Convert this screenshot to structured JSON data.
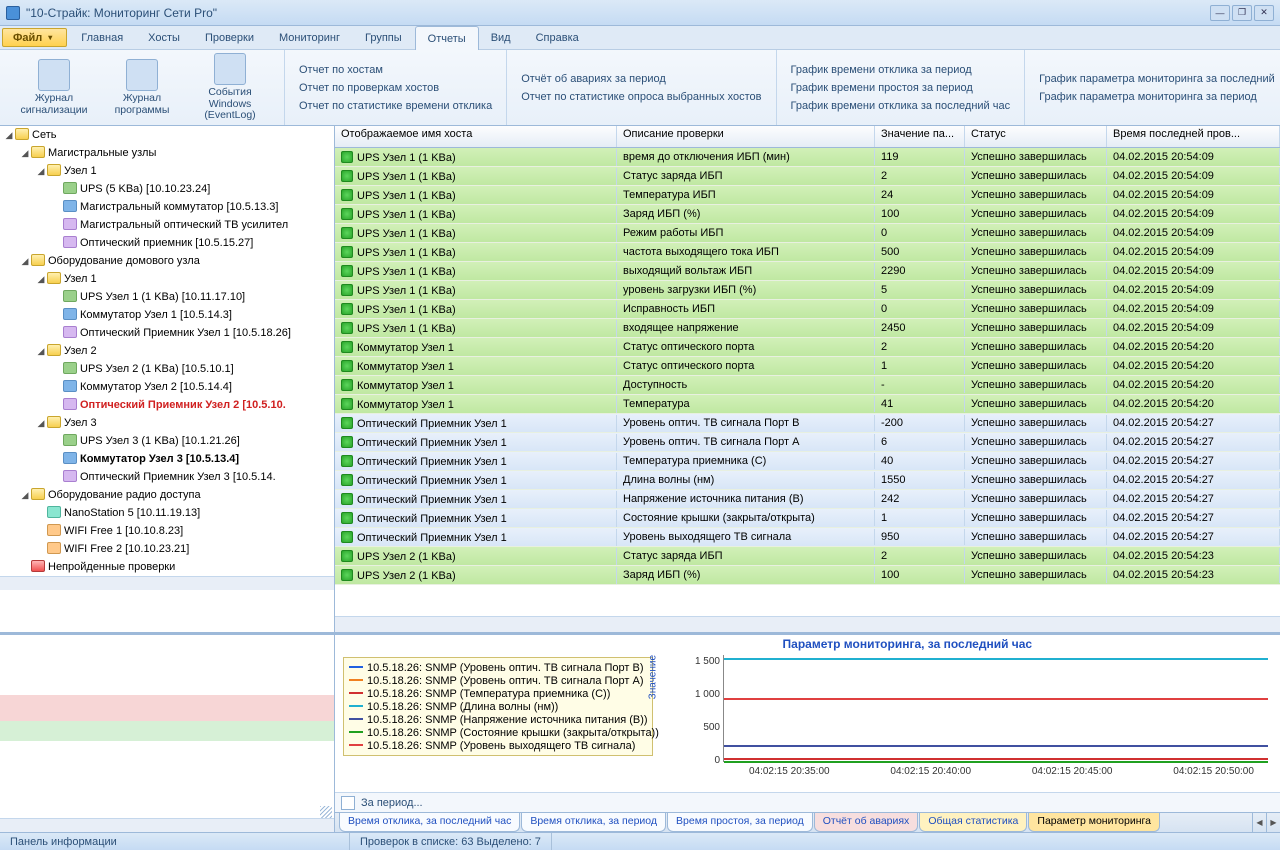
{
  "window_title": "\"10-Страйк: Мониторинг Сети Pro\"",
  "menu": {
    "file": "Файл",
    "items": [
      "Главная",
      "Хосты",
      "Проверки",
      "Мониторинг",
      "Группы",
      "Отчеты",
      "Вид",
      "Справка"
    ],
    "active_index": 5
  },
  "ribbon": {
    "buttons": [
      {
        "l1": "Журнал",
        "l2": "сигнализации"
      },
      {
        "l1": "Журнал",
        "l2": "программы"
      },
      {
        "l1": "События Windows",
        "l2": "(EventLog)"
      }
    ],
    "link_cols": [
      [
        "Отчет по хостам",
        "Отчет по проверкам хостов",
        "Отчет по статистике времени отклика"
      ],
      [
        "Отчёт об авариях за период",
        "Отчет по статистике опроса выбранных хостов"
      ],
      [
        "График времени отклика за период",
        "График времени простоя за период",
        "График времени отклика за последний час"
      ],
      [
        "График параметра мониторинга за последний",
        "График параметра мониторинга за период"
      ]
    ]
  },
  "tree": {
    "root": "Сеть",
    "failed_group": "Непройденные проверки",
    "groups": [
      {
        "name": "Магистральные узлы",
        "nodes": [
          {
            "name": "Узел 1",
            "items": [
              {
                "t": "ups",
                "label": "UPS (5 KBa) [10.10.23.24]"
              },
              {
                "t": "dev",
                "label": "Магистральный коммутатор [10.5.13.3]"
              },
              {
                "t": "opt",
                "label": "Магистральный оптический ТВ усилител"
              },
              {
                "t": "opt",
                "label": "Оптический приемник [10.5.15.27]"
              }
            ]
          }
        ]
      },
      {
        "name": "Оборудование домового узла",
        "nodes": [
          {
            "name": "Узел 1",
            "items": [
              {
                "t": "ups",
                "label": "UPS Узел 1 (1 KBa) [10.11.17.10]"
              },
              {
                "t": "dev",
                "label": "Коммутатор Узел 1 [10.5.14.3]"
              },
              {
                "t": "opt",
                "label": "Оптический Приемник Узел 1 [10.5.18.26]"
              }
            ]
          },
          {
            "name": "Узел 2",
            "items": [
              {
                "t": "ups",
                "label": "UPS Узел 2 (1 KBa) [10.5.10.1]"
              },
              {
                "t": "dev",
                "label": "Коммутатор Узел 2 [10.5.14.4]"
              },
              {
                "t": "opt",
                "label": "Оптический Приемник Узел 2 [10.5.10.",
                "red": true
              }
            ]
          },
          {
            "name": "Узел 3",
            "items": [
              {
                "t": "ups",
                "label": "UPS Узел 3 (1 KBa) [10.1.21.26]"
              },
              {
                "t": "dev",
                "label": "Коммутатор Узел 3 [10.5.13.4]",
                "bold": true
              },
              {
                "t": "opt",
                "label": "Оптический Приемник Узел 3 [10.5.14."
              }
            ]
          }
        ]
      },
      {
        "name": "Оборудование радио доступа",
        "leaf_items": [
          {
            "t": "ant",
            "label": "NanoStation 5 [10.11.19.13]"
          },
          {
            "t": "wifi",
            "label": "WIFI Free 1 [10.10.8.23]"
          },
          {
            "t": "wifi",
            "label": "WIFI Free 2 [10.10.23.21]"
          }
        ]
      }
    ]
  },
  "grid": {
    "cols": [
      "Отображаемое имя хоста",
      "Описание проверки",
      "Значение па...",
      "Статус",
      "Время последней пров..."
    ],
    "rows": [
      {
        "c": "green",
        "h": "UPS Узел 1 (1 KBa)",
        "d": "время до отключения ИБП (мин)",
        "v": "119",
        "s": "Успешно завершилась",
        "t": "04.02.2015 20:54:09"
      },
      {
        "c": "green",
        "h": "UPS Узел 1 (1 KBa)",
        "d": "Статус заряда ИБП",
        "v": "2",
        "s": "Успешно завершилась",
        "t": "04.02.2015 20:54:09"
      },
      {
        "c": "green",
        "h": "UPS Узел 1 (1 KBa)",
        "d": "Температура ИБП",
        "v": "24",
        "s": "Успешно завершилась",
        "t": "04.02.2015 20:54:09"
      },
      {
        "c": "green",
        "h": "UPS Узел 1 (1 KBa)",
        "d": "Заряд ИБП (%)",
        "v": "100",
        "s": "Успешно завершилась",
        "t": "04.02.2015 20:54:09"
      },
      {
        "c": "green",
        "h": "UPS Узел 1 (1 KBa)",
        "d": "Режим работы ИБП",
        "v": "0",
        "s": "Успешно завершилась",
        "t": "04.02.2015 20:54:09"
      },
      {
        "c": "green",
        "h": "UPS Узел 1 (1 KBa)",
        "d": "частота выходящего тока ИБП",
        "v": "500",
        "s": "Успешно завершилась",
        "t": "04.02.2015 20:54:09"
      },
      {
        "c": "green",
        "h": "UPS Узел 1 (1 KBa)",
        "d": "выходящий вольтаж ИБП",
        "v": "2290",
        "s": "Успешно завершилась",
        "t": "04.02.2015 20:54:09"
      },
      {
        "c": "green",
        "h": "UPS Узел 1 (1 KBa)",
        "d": "уровень загрузки ИБП (%)",
        "v": "5",
        "s": "Успешно завершилась",
        "t": "04.02.2015 20:54:09"
      },
      {
        "c": "green",
        "h": "UPS Узел 1 (1 KBa)",
        "d": "Исправность ИБП",
        "v": "0",
        "s": "Успешно завершилась",
        "t": "04.02.2015 20:54:09"
      },
      {
        "c": "green",
        "h": "UPS Узел 1 (1 KBa)",
        "d": "входящее напряжение",
        "v": "2450",
        "s": "Успешно завершилась",
        "t": "04.02.2015 20:54:09"
      },
      {
        "c": "green",
        "h": "Коммутатор Узел 1",
        "d": "Статус оптического порта",
        "v": "2",
        "s": "Успешно завершилась",
        "t": "04.02.2015 20:54:20"
      },
      {
        "c": "green",
        "h": "Коммутатор Узел 1",
        "d": "Статус оптического порта",
        "v": "1",
        "s": "Успешно завершилась",
        "t": "04.02.2015 20:54:20"
      },
      {
        "c": "green",
        "h": "Коммутатор Узел 1",
        "d": "Доступность",
        "v": "-",
        "s": "Успешно завершилась",
        "t": "04.02.2015 20:54:20"
      },
      {
        "c": "green",
        "h": "Коммутатор Узел 1",
        "d": "Температура",
        "v": "41",
        "s": "Успешно завершилась",
        "t": "04.02.2015 20:54:20"
      },
      {
        "c": "blue",
        "h": "Оптический Приемник Узел 1",
        "d": "Уровень оптич. ТВ сигнала Порт B",
        "v": "-200",
        "s": "Успешно завершилась",
        "t": "04.02.2015 20:54:27"
      },
      {
        "c": "blue",
        "h": "Оптический Приемник Узел 1",
        "d": "Уровень оптич. ТВ сигнала Порт A",
        "v": "6",
        "s": "Успешно завершилась",
        "t": "04.02.2015 20:54:27"
      },
      {
        "c": "blue",
        "h": "Оптический Приемник Узел 1",
        "d": "Температура приемника (С)",
        "v": "40",
        "s": "Успешно завершилась",
        "t": "04.02.2015 20:54:27"
      },
      {
        "c": "blue",
        "h": "Оптический Приемник Узел 1",
        "d": "Длина волны (нм)",
        "v": "1550",
        "s": "Успешно завершилась",
        "t": "04.02.2015 20:54:27"
      },
      {
        "c": "blue",
        "h": "Оптический Приемник Узел 1",
        "d": "Напряжение источника питания (В)",
        "v": "242",
        "s": "Успешно завершилась",
        "t": "04.02.2015 20:54:27"
      },
      {
        "c": "blue",
        "h": "Оптический Приемник Узел 1",
        "d": "Состояние крышки (закрыта/открыта)",
        "v": "1",
        "s": "Успешно завершилась",
        "t": "04.02.2015 20:54:27"
      },
      {
        "c": "blue",
        "h": "Оптический Приемник Узел 1",
        "d": "Уровень выходящего ТВ сигнала",
        "v": "950",
        "s": "Успешно завершилась",
        "t": "04.02.2015 20:54:27"
      },
      {
        "c": "green",
        "h": "UPS Узел 2 (1 KBa)",
        "d": "Статус заряда ИБП",
        "v": "2",
        "s": "Успешно завершилась",
        "t": "04.02.2015 20:54:23"
      },
      {
        "c": "green",
        "h": "UPS Узел 2 (1 KBa)",
        "d": "Заряд ИБП (%)",
        "v": "100",
        "s": "Успешно завершилась",
        "t": "04.02.2015 20:54:23"
      }
    ]
  },
  "chart_data": {
    "type": "line",
    "title": "Параметр мониторинга, за последний час",
    "ylabel": "Значение",
    "ylim": [
      0,
      1600
    ],
    "yticks": [
      0,
      500,
      1000,
      1500
    ],
    "x_labels": [
      "04:02:15 20:35:00",
      "04:02:15 20:40:00",
      "04:02:15 20:45:00",
      "04:02:15 20:50:00"
    ],
    "series": [
      {
        "name": "10.5.18.26: SNMP (Уровень оптич. ТВ сигнала Порт B)",
        "value": -200,
        "color": "#2060e0"
      },
      {
        "name": "10.5.18.26: SNMP (Уровень оптич. ТВ сигнала Порт A)",
        "value": 6,
        "color": "#f08020"
      },
      {
        "name": "10.5.18.26: SNMP (Температура приемника (С))",
        "value": 40,
        "color": "#d03030"
      },
      {
        "name": "10.5.18.26: SNMP (Длина волны (нм))",
        "value": 1550,
        "color": "#20b0d0"
      },
      {
        "name": "10.5.18.26: SNMP (Напряжение источника питания (В))",
        "value": 242,
        "color": "#4050a0"
      },
      {
        "name": "10.5.18.26: SNMP (Состояние крышки (закрыта/открыта))",
        "value": 1,
        "color": "#20a020"
      },
      {
        "name": "10.5.18.26: SNMP (Уровень выходящего ТВ сигнала)",
        "value": 950,
        "color": "#e04040"
      }
    ]
  },
  "period_label": "За период...",
  "bottom_tabs": [
    {
      "label": "Время отклика, за последний час",
      "cls": ""
    },
    {
      "label": "Время отклика, за период",
      "cls": ""
    },
    {
      "label": "Время простоя, за период",
      "cls": ""
    },
    {
      "label": "Отчёт об авариях",
      "cls": "red"
    },
    {
      "label": "Общая статистика",
      "cls": "yellow"
    },
    {
      "label": "Параметр мониторинга",
      "cls": "active"
    }
  ],
  "status": {
    "left": "Панель информации",
    "right": "Проверок в списке: 63  Выделено: 7"
  }
}
